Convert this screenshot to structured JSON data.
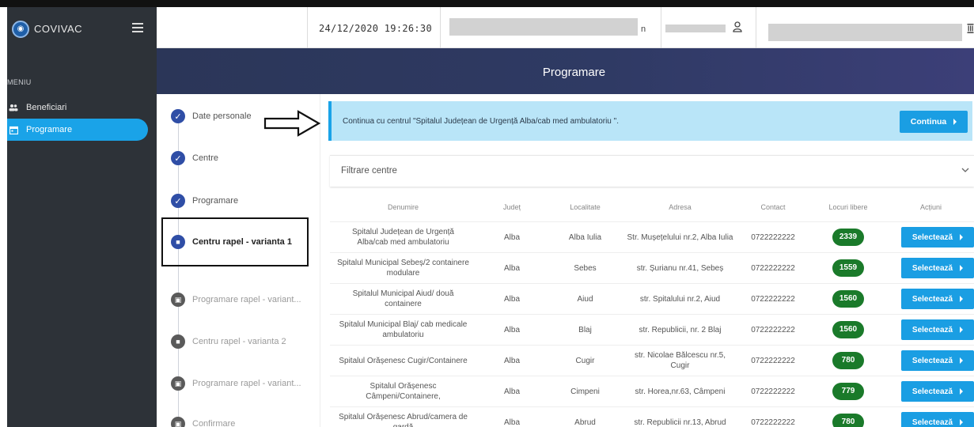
{
  "brand": {
    "name": "COVIVAC"
  },
  "sidebar": {
    "menu_label": "MENIU",
    "items": [
      {
        "label": "Beneficiari",
        "icon": "users-icon",
        "active": false
      },
      {
        "label": "Programare",
        "icon": "calendar-icon",
        "active": true
      }
    ]
  },
  "header": {
    "datetime": "24/12/2020 19:26:30",
    "fragment": "n"
  },
  "page": {
    "title": "Programare"
  },
  "stepper": {
    "steps": [
      {
        "label": "Date personale",
        "state": "done"
      },
      {
        "label": "Centre",
        "state": "done"
      },
      {
        "label": "Programare",
        "state": "done"
      },
      {
        "label": "Centru rapel - varianta 1",
        "state": "current"
      },
      {
        "label": "Programare rapel - variant...",
        "state": "pending"
      },
      {
        "label": "Centru rapel - varianta 2",
        "state": "pending"
      },
      {
        "label": "Programare rapel - variant...",
        "state": "pending"
      },
      {
        "label": "Confirmare",
        "state": "pending"
      }
    ]
  },
  "info": {
    "message": "Continua cu centrul \"Spitalul Județean de Urgență Alba/cab med ambulatoriu \".",
    "continue_label": "Continua"
  },
  "filter": {
    "label": "Filtrare centre"
  },
  "table": {
    "headers": [
      "Denumire",
      "Județ",
      "Localitate",
      "Adresa",
      "Contact",
      "Locuri libere",
      "Acțiuni"
    ],
    "select_label": "Selectează",
    "rows": [
      {
        "name": "Spitalul Județean de Urgență Alba/cab med ambulatoriu",
        "county": "Alba",
        "city": "Alba Iulia",
        "address": "Str. Mușețelului nr.2, Alba Iulia",
        "contact": "0722222222",
        "free": "2339"
      },
      {
        "name": "Spitalul Municipal Sebeș/2 containere modulare",
        "county": "Alba",
        "city": "Sebes",
        "address": "str. Șurianu nr.41, Sebeș",
        "contact": "0722222222",
        "free": "1559"
      },
      {
        "name": "Spitalul Municipal Aiud/ două containere",
        "county": "Alba",
        "city": "Aiud",
        "address": "str. Spitalului nr.2, Aiud",
        "contact": "0722222222",
        "free": "1560"
      },
      {
        "name": "Spitalul Municipal Blaj/ cab medicale ambulatoriu",
        "county": "Alba",
        "city": "Blaj",
        "address": "str. Republicii, nr. 2 Blaj",
        "contact": "0722222222",
        "free": "1560"
      },
      {
        "name": "Spitalul Orășenesc Cugir/Containere",
        "county": "Alba",
        "city": "Cugir",
        "address": "str. Nicolae Bălcescu nr.5, Cugir",
        "contact": "0722222222",
        "free": "780"
      },
      {
        "name": "Spitalul Orășenesc Câmpeni/Containere,",
        "county": "Alba",
        "city": "Cimpeni",
        "address": "str. Horea,nr.63, Câmpeni",
        "contact": "0722222222",
        "free": "779"
      },
      {
        "name": "Spitalul Orășenesc Abrud/camera de gardă",
        "county": "Alba",
        "city": "Abrud",
        "address": "str. Republicii nr.13, Abrud",
        "contact": "0722222222",
        "free": "780"
      }
    ]
  },
  "colors": {
    "accent": "#1a9ee3",
    "sidebar": "#2d3238",
    "badge": "#1a7a2a",
    "step_done": "#2f4ea6",
    "banner": "#2b3658"
  }
}
